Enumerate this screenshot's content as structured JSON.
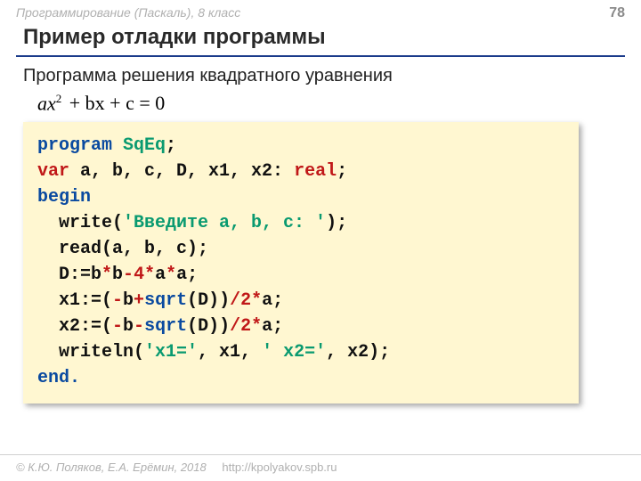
{
  "header": {
    "course": "Программирование (Паскаль), 8 класс",
    "page": "78"
  },
  "title": "Пример отладки программы",
  "subtitle": "Программа решения квадратного уравнения",
  "formula": {
    "a": "ax",
    "exp": "2",
    "rest1": " + bx + c = 0"
  },
  "code": {
    "l1_a": "program ",
    "l1_b": "SqEq",
    "l1_c": ";",
    "l2_a": "var",
    "l2_b": " a, b, c, D, x1, x2: ",
    "l2_c": "real",
    "l2_d": ";",
    "l3": "begin",
    "l4_a": "  write(",
    "l4_b": "'Введите a, b, c: '",
    "l4_c": ");",
    "l5": "  read(a, b, c);",
    "l6_a": "  D:=b",
    "l6_b": "*",
    "l6_c": "b",
    "l6_d": "-",
    "l6_e": "4",
    "l6_f": "*",
    "l6_g": "a",
    "l6_h": "*",
    "l6_i": "a;",
    "l7_a": "  x1:=(",
    "l7_b": "-",
    "l7_c": "b",
    "l7_d": "+",
    "l7_e": "sqrt",
    "l7_f": "(D))",
    "l7_g": "/",
    "l7_h": "2",
    "l7_i": "*",
    "l7_j": "a;",
    "l8_a": "  x2:=(",
    "l8_b": "-",
    "l8_c": "b",
    "l8_d": "-",
    "l8_e": "sqrt",
    "l8_f": "(D))",
    "l8_g": "/",
    "l8_h": "2",
    "l8_i": "*",
    "l8_j": "a;",
    "l9_a": "  writeln(",
    "l9_b": "'x1='",
    "l9_c": ", x1, ",
    "l9_d": "' x2='",
    "l9_e": ", x2);",
    "l10": "end."
  },
  "footer": {
    "copyright": "© К.Ю. Поляков, Е.А. Ерёмин, 2018",
    "url": "http://kpolyakov.spb.ru"
  }
}
